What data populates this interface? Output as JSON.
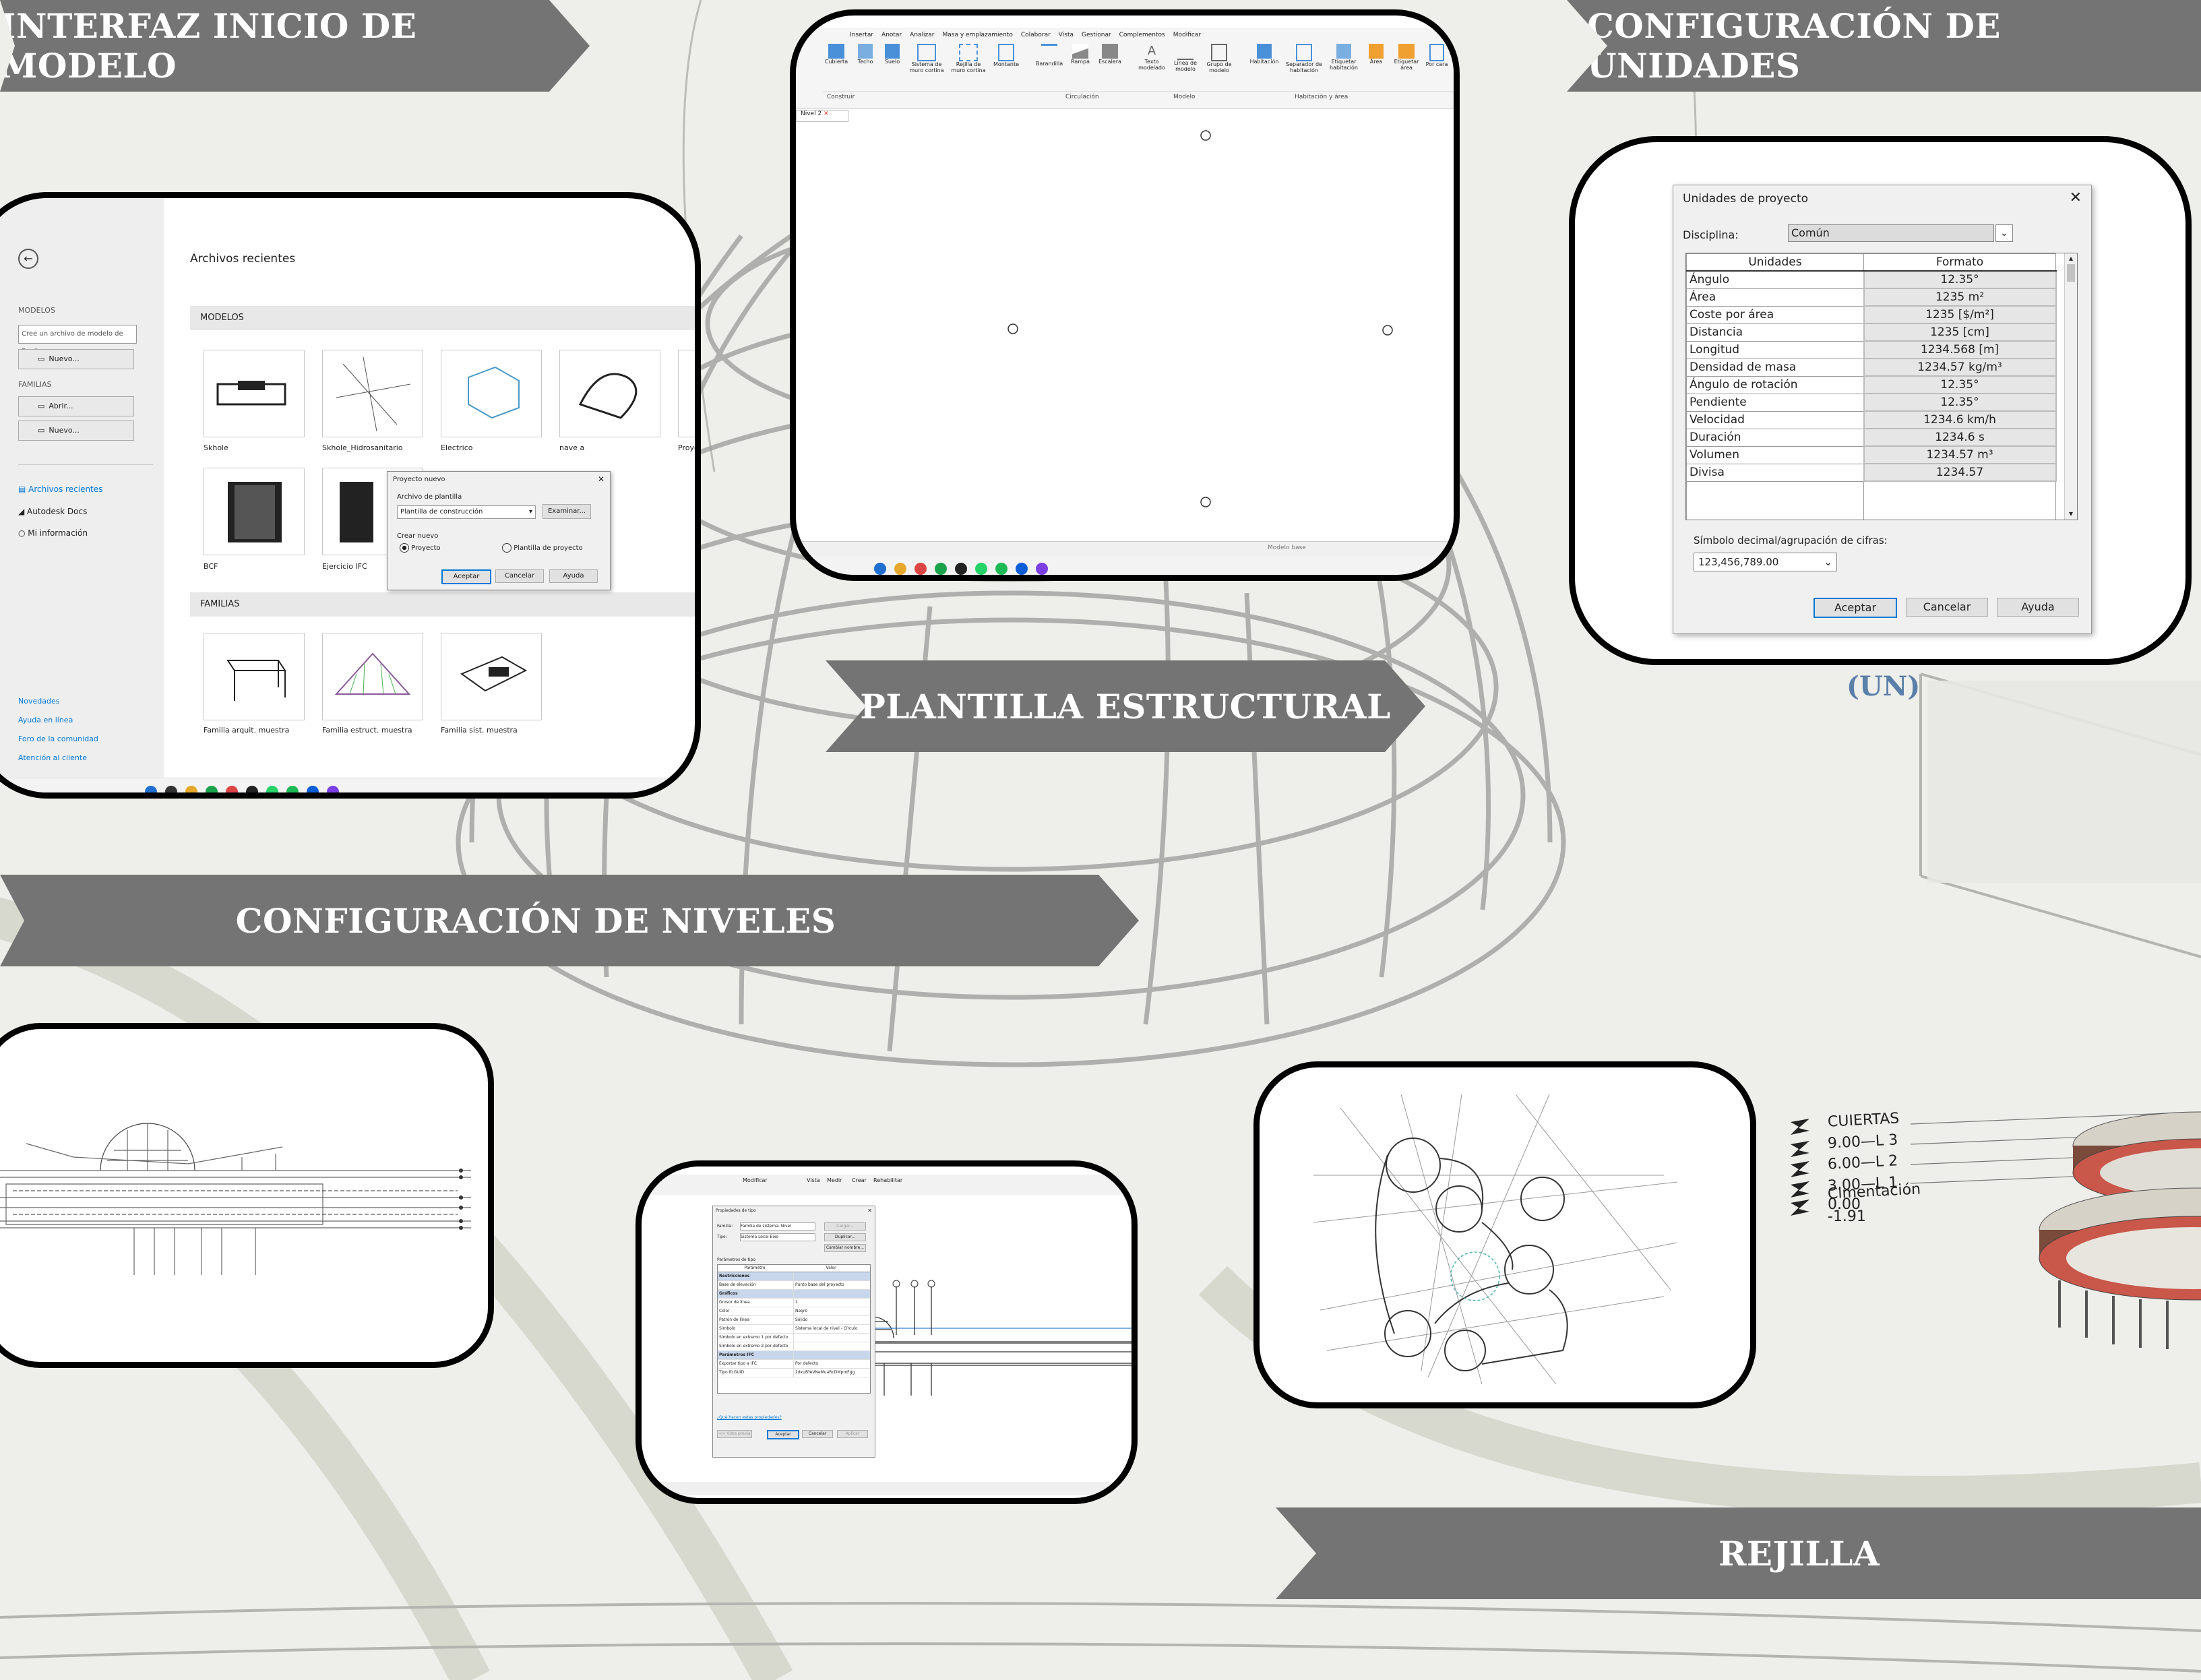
{
  "banners": {
    "inicio": "INTERFAZ INICIO DE MODELO",
    "unidades": "CONFIGURACIÓN DE UNIDADES",
    "plantilla": "PLANTILLA ESTRUCTURAL",
    "niveles": "CONFIGURACIÓN DE NIVELES",
    "rejilla": "REJILLA"
  },
  "un_label": "(UN)",
  "start_screen": {
    "recent_title": "Archivos recientes",
    "sidebar": {
      "modelos": "MODELOS",
      "create_input": "Cree un archivo de modelo de Revit",
      "nuevo": "Nuevo...",
      "familias": "FAMILIAS",
      "abrir": "Abrir...",
      "nuevo2": "Nuevo...",
      "nav": [
        "Archivos recientes",
        "Autodesk Docs",
        "Mi información"
      ],
      "links": [
        "Novedades",
        "Ayuda en línea",
        "Foro de la comunidad",
        "Atención al cliente"
      ]
    },
    "models_header": "MODELOS",
    "models": [
      "Skhole",
      "Skhole_Hidrosanitario",
      "Electrico",
      "nave a",
      "Proye",
      "BCF",
      "Ejercicio IFC"
    ],
    "families_header": "FAMILIAS",
    "families": [
      "Familia arquit. muestra",
      "Familia estruct. muestra",
      "Familia sist. muestra"
    ],
    "dialog": {
      "title": "Proyecto nuevo",
      "template_label": "Archivo de plantilla",
      "template_value": "Plantilla de construcción",
      "browse": "Examinar...",
      "create_label": "Crear nuevo",
      "radio_project": "Proyecto",
      "radio_template": "Plantilla de proyecto",
      "ok": "Aceptar",
      "cancel": "Cancelar",
      "help": "Ayuda"
    }
  },
  "ribbon": {
    "tabs": [
      "Insertar",
      "Anotar",
      "Analizar",
      "Masa y emplazamiento",
      "Colaborar",
      "Vista",
      "Gestionar",
      "Complementos",
      "Modificar"
    ],
    "tools": [
      "Cubierta",
      "Techo",
      "Suelo",
      "Sistema de muro cortina",
      "Rejilla de muro cortina",
      "Montante",
      "Barandilla",
      "Rampa",
      "Escalera",
      "Texto modelado",
      "Línea de modelo",
      "Grupo de modelo",
      "Habitación",
      "Separador de habitación",
      "Etiquetar habitación",
      "Área",
      "Etiquetar área",
      "Por cara"
    ],
    "groups": [
      "Construir",
      "Circulación",
      "Modelo",
      "Habitación y área"
    ],
    "view_tab": "Nivel 2",
    "status_model": "Modelo base"
  },
  "units_dialog": {
    "title": "Unidades de proyecto",
    "discipline_label": "Disciplina:",
    "discipline_value": "Común",
    "col_units": "Unidades",
    "col_format": "Formato",
    "rows": [
      {
        "unit": "Ángulo",
        "format": "12.35°"
      },
      {
        "unit": "Área",
        "format": "1235 m²"
      },
      {
        "unit": "Coste por área",
        "format": "1235 [$/m²]"
      },
      {
        "unit": "Distancia",
        "format": "1235 [cm]"
      },
      {
        "unit": "Longitud",
        "format": "1234.568 [m]"
      },
      {
        "unit": "Densidad de masa",
        "format": "1234.57 kg/m³"
      },
      {
        "unit": "Ángulo de rotación",
        "format": "12.35°"
      },
      {
        "unit": "Pendiente",
        "format": "12.35°"
      },
      {
        "unit": "Velocidad",
        "format": "1234.6 km/h"
      },
      {
        "unit": "Duración",
        "format": "1234.6 s"
      },
      {
        "unit": "Volumen",
        "format": "1234.57 m³"
      },
      {
        "unit": "Divisa",
        "format": "1234.57"
      }
    ],
    "decimal_label": "Símbolo decimal/agrupación de cifras:",
    "decimal_value": "123,456,789.00",
    "ok": "Aceptar",
    "cancel": "Cancelar",
    "help": "Ayuda"
  },
  "type_props": {
    "title": "Propiedades de tipo",
    "family_label": "Familia:",
    "family_value": "Familia de sistema: Nivel",
    "type_label": "Tipo:",
    "type_value": "Sistema Local Eixo",
    "load": "Cargar...",
    "duplicate": "Duplicar...",
    "rename": "Cambiar nombre...",
    "params_label": "Parámetros de tipo",
    "col_param": "Parámetro",
    "col_value": "Valor",
    "rows": [
      {
        "p": "Restricciones",
        "v": "",
        "h": true
      },
      {
        "p": "Base de elevación",
        "v": "Punto base del proyecto",
        "h": false
      },
      {
        "p": "Gráficos",
        "v": "",
        "h": true
      },
      {
        "p": "Grosor de línea",
        "v": "1",
        "h": false
      },
      {
        "p": "Color",
        "v": "Negro",
        "h": false
      },
      {
        "p": "Patrón de línea",
        "v": "Sólido",
        "h": false
      },
      {
        "p": "Símbolo",
        "v": "Sistema local de nivel - Círculo",
        "h": false
      },
      {
        "p": "Símbolo en extremo 1 por defecto",
        "v": "",
        "h": false
      },
      {
        "p": "Símbolo en extremo 2 por defecto",
        "v": "",
        "h": false
      },
      {
        "p": "Parámetros IFC",
        "v": "",
        "h": true
      },
      {
        "p": "Exportar tipo a IFC",
        "v": "Por defecto",
        "h": false
      },
      {
        "p": "Tipo IfcGUID",
        "v": "2dxuBYeVNeMuaRcDMpmFgg",
        "h": false
      }
    ],
    "link": "¿Qué hacen estas propiedades?",
    "preview": "<< Vista previa",
    "ok": "Aceptar",
    "cancel": "Cancelar",
    "apply": "Aplicar",
    "top_tabs": [
      "Modificar",
      "Vista",
      "Medir",
      "Crear",
      "Rehabilitar"
    ]
  },
  "levels": [
    {
      "name": "CUIERTAS"
    },
    {
      "name": "9.00—L 3"
    },
    {
      "name": "6.00—L 2"
    },
    {
      "name": "3.00—L 1"
    },
    {
      "name": "Cimentación"
    },
    {
      "name": "0.00"
    },
    {
      "name": "-1.91"
    }
  ],
  "colors": {
    "banner": "#747474",
    "accent": "#0078d7",
    "un": "#5a7fa8",
    "panel_border": "#000000"
  }
}
